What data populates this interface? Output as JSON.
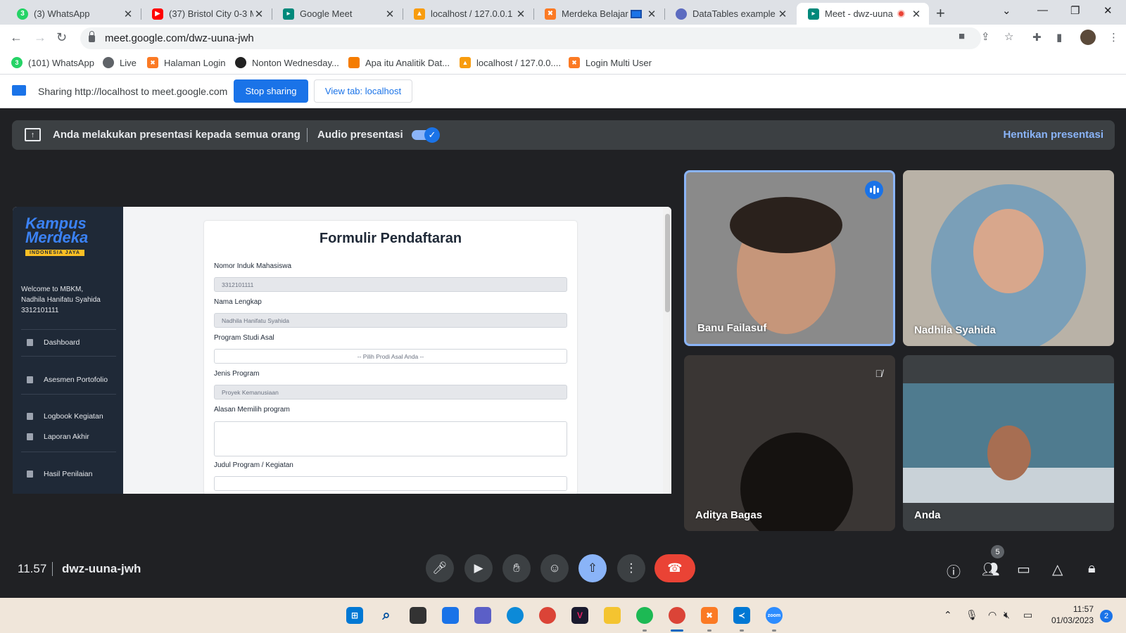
{
  "browser": {
    "tabs": [
      {
        "title": "(3) WhatsApp",
        "icon": "whatsapp-icon",
        "color": "#25d366"
      },
      {
        "title": "(37) Bristol City 0-3 M",
        "icon": "youtube-icon",
        "color": "#ff0000"
      },
      {
        "title": "Google Meet",
        "icon": "meet-icon",
        "color": "#00897b"
      },
      {
        "title": "localhost / 127.0.0.1 /",
        "icon": "phpmyadmin-icon",
        "color": "#f89c0e"
      },
      {
        "title": "Merdeka Belajar K",
        "icon": "xampp-icon",
        "color": "#fb7a24"
      },
      {
        "title": "DataTables example -",
        "icon": "datatables-icon",
        "color": "#5c6bc0"
      },
      {
        "title": "Meet - dwz-uuna",
        "icon": "meet-icon",
        "color": "#00897b"
      }
    ],
    "url": "meet.google.com/dwz-uuna-jwh",
    "bookmarks": [
      {
        "label": "(101) WhatsApp",
        "color": "#25d366"
      },
      {
        "label": "Live",
        "color": "#5f6368"
      },
      {
        "label": "Halaman Login",
        "color": "#fb7a24"
      },
      {
        "label": "Nonton Wednesday...",
        "color": "#222222"
      },
      {
        "label": "Apa itu Analitik Dat...",
        "color": "#f57c00"
      },
      {
        "label": "localhost / 127.0.0....",
        "color": "#f89c0e"
      },
      {
        "label": "Login Multi User",
        "color": "#fb7a24"
      }
    ]
  },
  "sharing_bar": {
    "text": "Sharing http://localhost to meet.google.com",
    "stop_label": "Stop sharing",
    "view_label": "View tab: localhost"
  },
  "presentation_bar": {
    "text": "Anda melakukan presentasi kepada semua orang",
    "audio_label": "Audio presentasi",
    "audio_on": true,
    "stop_label": "Hentikan presentasi"
  },
  "shared_screen": {
    "logo": {
      "line1": "Kampus",
      "line2": "Merdeka",
      "tagline": "INDONESIA JAYA"
    },
    "welcome": [
      "Welcome to MBKM,",
      "Nadhila Hanifatu Syahida",
      "3312101111"
    ],
    "menu": [
      "Dashboard",
      "Asesmen Portofolio",
      "Logbook Kegiatan",
      "Laporan Akhir",
      "Hasil Penilaian"
    ],
    "form": {
      "title": "Formulir Pendaftaran",
      "nim_label": "Nomor Induk Mahasiswa",
      "nim_value": "3312101111",
      "nama_label": "Nama Lengkap",
      "nama_value": "Nadhila Hanifatu Syahida",
      "prodi_label": "Program Studi Asal",
      "prodi_placeholder": "-- Pilih Prodi Asal Anda --",
      "jenis_label": "Jenis Program",
      "jenis_value": "Proyek Kemanusiaan",
      "alasan_label": "Alasan Memilih program",
      "judul_label": "Judul Program / Kegiatan"
    }
  },
  "participants": [
    {
      "name": "Banu Failasuf",
      "speaking": true
    },
    {
      "name": "Nadhila Syahida"
    },
    {
      "name": "Aditya Bagas",
      "muted": true
    },
    {
      "name": "Anda"
    }
  ],
  "call": {
    "time": "11.57",
    "code": "dwz-uuna-jwh",
    "people_count": "5"
  },
  "taskbar": {
    "time": "11:57",
    "date": "01/03/2023",
    "notifications": "2"
  }
}
